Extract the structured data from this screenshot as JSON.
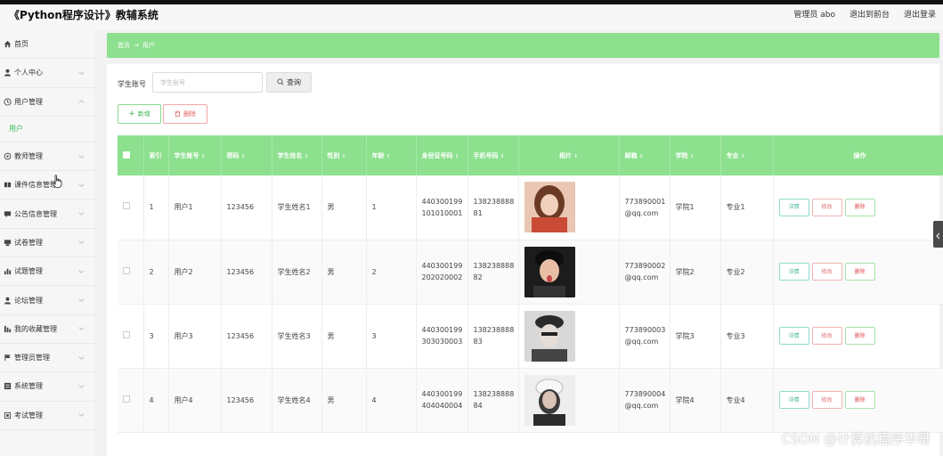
{
  "app": {
    "title": "《Python程序设计》教辅系统"
  },
  "header": {
    "admin_label": "管理员 abo",
    "front_link": "退出到前台",
    "logout_link": "退出登录"
  },
  "sidebar": {
    "items": [
      {
        "label": "首页",
        "icon": "home-icon"
      },
      {
        "label": "个人中心",
        "icon": "user-icon"
      },
      {
        "label": "用户管理",
        "icon": "clock-icon"
      },
      {
        "label": "教师管理",
        "icon": "settings-icon"
      },
      {
        "label": "课件信息管理",
        "icon": "book-icon"
      },
      {
        "label": "公告信息管理",
        "icon": "chat-icon"
      },
      {
        "label": "试卷管理",
        "icon": "doc-icon"
      },
      {
        "label": "试题管理",
        "icon": "chart-icon"
      },
      {
        "label": "论坛管理",
        "icon": "user-icon"
      },
      {
        "label": "我的收藏管理",
        "icon": "bar-icon"
      },
      {
        "label": "管理员管理",
        "icon": "flag-icon"
      },
      {
        "label": "系统管理",
        "icon": "grid-icon"
      },
      {
        "label": "考试管理",
        "icon": "box-icon"
      }
    ],
    "sub_item": "用户"
  },
  "breadcrumb": {
    "home": "首页",
    "arrow": "→",
    "current": "用户"
  },
  "search": {
    "label": "学生账号",
    "placeholder": "学生账号",
    "button": "查询"
  },
  "actions": {
    "add": "新增",
    "delete": "删除"
  },
  "table": {
    "headers": [
      "索引",
      "学生账号",
      "密码",
      "学生姓名",
      "性别",
      "年龄",
      "身份证号码",
      "手机号码",
      "相片",
      "邮箱",
      "学院",
      "专业",
      "操作"
    ],
    "rows": [
      {
        "index": "1",
        "account": "用户1",
        "password": "123456",
        "name": "学生姓名1",
        "gender": "男",
        "age": "1",
        "id1": "440300199",
        "id2": "101010001",
        "phone1": "138238888",
        "phone2": "81",
        "email1": "773890001",
        "email2": "@qq.com",
        "college": "学院1",
        "major": "专业1"
      },
      {
        "index": "2",
        "account": "用户2",
        "password": "123456",
        "name": "学生姓名2",
        "gender": "男",
        "age": "2",
        "id1": "440300199",
        "id2": "202020002",
        "phone1": "138238888",
        "phone2": "82",
        "email1": "773890002",
        "email2": "@qq.com",
        "college": "学院2",
        "major": "专业2"
      },
      {
        "index": "3",
        "account": "用户3",
        "password": "123456",
        "name": "学生姓名3",
        "gender": "男",
        "age": "3",
        "id1": "440300199",
        "id2": "303030003",
        "phone1": "138238888",
        "phone2": "83",
        "email1": "773890003",
        "email2": "@qq.com",
        "college": "学院3",
        "major": "专业3"
      },
      {
        "index": "4",
        "account": "用户4",
        "password": "123456",
        "name": "学生姓名4",
        "gender": "男",
        "age": "4",
        "id1": "440300199",
        "id2": "404040004",
        "phone1": "138238888",
        "phone2": "84",
        "email1": "773890004",
        "email2": "@qq.com",
        "college": "学院4",
        "major": "专业4"
      }
    ],
    "ops": {
      "detail": "详情",
      "edit": "修改",
      "delete": "删除"
    }
  },
  "watermark": "CSDN @计算机程序华哥",
  "colors": {
    "accent": "#8ce08e",
    "link": "#39c15b"
  }
}
